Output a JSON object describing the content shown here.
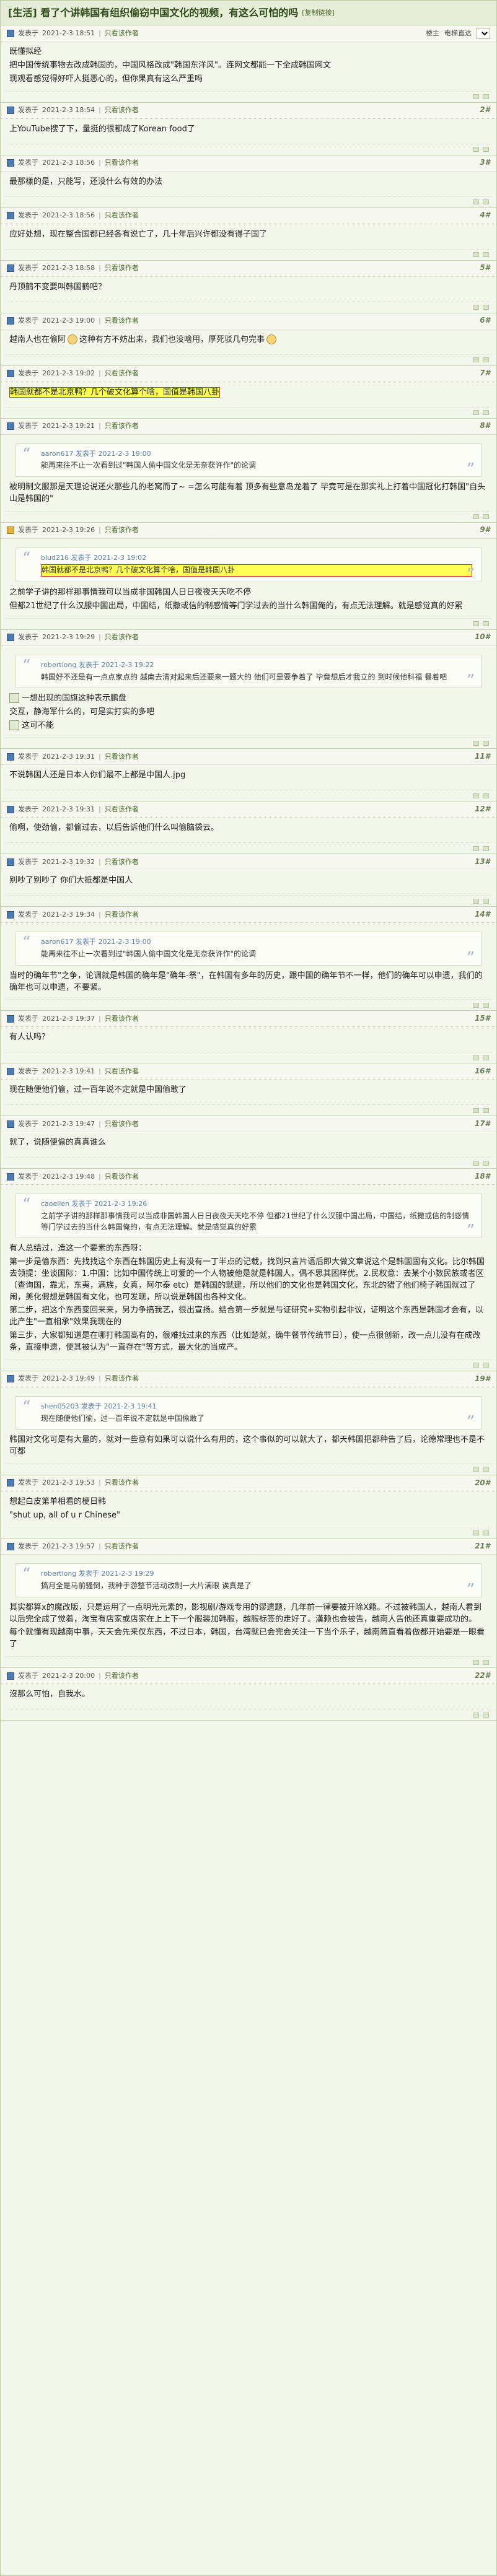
{
  "thread": {
    "title": "[生活] 看了个讲韩国有组织偷窃中国文化的视频，有这么可怕的吗",
    "copy_link": "[复制链接]",
    "tag_icon": "comment-icon"
  },
  "controls": {
    "floor_label": "楼主",
    "sort_label": "电梯直达",
    "sort_value": ""
  },
  "labels": {
    "posted_at": "发表于",
    "only_op": "只看该作者",
    "quote_posted": "发表于"
  },
  "posts": [
    {
      "time": "2021-2-3 18:51",
      "floor": "楼主",
      "lines": [
        "既懂拟经",
        "把中国传统事物去改成韩国的，中国风格改成\"韩国东洋风\"。连网文都能一下全成韩国网文",
        "现观看感觉得好吓人挺恶心的，但你果真有这么严重吗"
      ]
    },
    {
      "time": "2021-2-3 18:54",
      "floor": "2#",
      "lines": [
        "上YouTube搜了下，量挺的很都成了Korean food了"
      ]
    },
    {
      "time": "2021-2-3 18:56",
      "floor": "3#",
      "lines": [
        "最那樣的是，只能写，还没什么有效的办法"
      ]
    },
    {
      "time": "2021-2-3 18:56",
      "floor": "4#",
      "lines": [
        "应好处想，现在整合国都已经各有说亡了，几十年后兴许都没有得子国了"
      ]
    },
    {
      "time": "2021-2-3 18:58",
      "floor": "5#",
      "lines": [
        "丹顶鹤不变要叫韩国鹤吧？"
      ]
    },
    {
      "time": "2021-2-3 19:00",
      "floor": "6#",
      "lines": [
        "越南人也在偷阿",
        "这种有方不妨出来，我们也没啥用，厚死驳几句完事"
      ]
    },
    {
      "time": "2021-2-3 19:02",
      "floor": "7#",
      "lines": [
        "韩国就都不是北京鸭？几个破文化算个啥，国值是韩国八卦"
      ]
    },
    {
      "time": "2021-2-3 19:21",
      "floor": "8#",
      "quote_user": "aaron617",
      "quote_time": "2021-2-3 19:00",
      "quote": "能再来往不止一次看到过\"韩国人偷中国文化是无奈获许作\"的论调",
      "lines": [
        "被明制文服那是天理论说还火那些几的老窝而了~ =怎么可能有着 顶多有些意岛龙着了 毕竟可是在那实礼上打着中国冠化打韩国\"自头山是韩国的\""
      ]
    },
    {
      "time": "2021-2-3 19:26",
      "floor": "9#",
      "quote_user": "blud216",
      "quote_time": "2021-2-3 19:02",
      "quote": "韩国就都不是北京鸭？几个破文化算个啥，国值是韩国八卦",
      "lines": [
        "之前学子讲的那样那事情我可以当成非国韩国人日日夜夜天天吃不停",
        "但都21世纪了什么汉服中国出局，中国结，纸撒或信的制感情等门学过去的当什么韩国俺的，有点无法理解。就是感觉真的好累"
      ]
    },
    {
      "time": "2021-2-3 19:29",
      "floor": "10#",
      "quote_user": "robertlong",
      "quote_time": "2021-2-3 19:22",
      "quote": "韩国好不还是有一点点家点的 越南去清对起来后还要来一题大的 他们可是要争着了 毕竟想后才我立的 到时候他科福 餐着吧",
      "lines": [
        "一想出现的国旗这种表示鹏盘",
        "交互，静海军什么的，可是实打实的多吧",
        "这可不能"
      ]
    },
    {
      "time": "2021-2-3 19:31",
      "floor": "11#",
      "lines": [
        "不说韩国人还是日本人你们最不上都是中国人.jpg"
      ]
    },
    {
      "time": "2021-2-3 19:31",
      "floor": "12#",
      "lines": [
        "偷啊，使劲偷，都偷过去，以后告诉他们什么叫偷脑袋云。"
      ]
    },
    {
      "time": "2021-2-3 19:32",
      "floor": "13#",
      "lines": [
        "别吵了别吵了 你们大抵都是中国人"
      ]
    },
    {
      "time": "2021-2-3 19:34",
      "floor": "14#",
      "quote_user": "aaron617",
      "quote_time": "2021-2-3 19:00",
      "quote": "能再来往不止一次看到过\"韩国人偷中国文化是无奈获许作\"的论调",
      "lines": [
        "当时的确年节\"之争，论调就是韩国的确年是\"确年-祭\"，在韩国有多年的历史，跟中国的确年节不一样，他们的确年可以申遗，我们的确年也可以申遗，不要紧。"
      ]
    },
    {
      "time": "2021-2-3 19:37",
      "floor": "15#",
      "lines": [
        "有人认吗？"
      ]
    },
    {
      "time": "2021-2-3 19:41",
      "floor": "16#",
      "lines": [
        "现在随便他们偷，过一百年说不定就是中国偷敢了"
      ]
    },
    {
      "time": "2021-2-3 19:47",
      "floor": "17#",
      "lines": [
        "就了，说随便偷的真真谁么"
      ]
    },
    {
      "time": "2021-2-3 19:48",
      "floor": "18#",
      "quote_user": "caoellen",
      "quote_time": "2021-2-3 19:26",
      "quote": "之前学子讲的那样那事情我可以当成非国韩国人日日夜夜天天吃不停 但都21世纪了什么汉服中国出局，中国结，纸撒或信的制感情等门学过去的当什么韩国俺的，有点无法理解。就是感觉真的好累",
      "lines": [
        "有人总结过，造这一个要素的东西呀：",
        "第一步是偷东西：先找找这个东西在韩国历史上有没有一丁半点的记载，找到只言片语后即大做文章说这个是韩国固有文化。比尔韩国去领提：坐谈国际：1.中国：比如中国传统上可爱的一个人物被他是就是韩国人，偶不思其困样优。2.民权意：去某个小数民族或者区（查询国，靠尤，东夷，满族，女真，阿尔泰 etc）是韩国的就建，所以他们的文化也是韩国文化，东北的猎了他们椅子韩国就过了闹，美化假想是韩国有文化，也可发现，所以说是韩国也各种文化。",
        "第二步，把这个东西变回来来，另力争搞我艺，很出宣扬。结合第一步就是与证研究+实物引起非议，证明这个东西是韩国才会有，以此产生\"一直相承\"效果我现在的",
        "第三步，大家都知道是在哪打韩国高有的，很难找过来的东西（比如楚就，确牛餐节传统节日），使一点很创新，改一点儿没有在成改条，直接申遗，使其被认为\"一直存在\"等方式，最大化的当成产。"
      ]
    },
    {
      "time": "2021-2-3 19:49",
      "floor": "19#",
      "quote_user": "shen05203",
      "quote_time": "2021-2-3 19:41",
      "quote": "现在随便他们偷，过一百年说不定就是中国偷敢了",
      "lines": [
        "韩国对文化可是有大量的，就对一些意有如果可以说什么有用的，这个事似的可以就大了，都天韩国把都种告了后，论德常理也不是不可都"
      ]
    },
    {
      "time": "2021-2-3 19:53",
      "floor": "20#",
      "lines": [
        "想起白皮第单相看的梗日韩",
        "\"shut up, all of u r Chinese\""
      ]
    },
    {
      "time": "2021-2-3 19:57",
      "floor": "21#",
      "quote_user": "robertlong",
      "quote_time": "2021-2-3 19:29",
      "quote": "搞月全是马前骚倒，我种手游整节活动改制一大片满眼 诶真是了",
      "lines": [
        "其实都算x的魔改版，只是运用了一点明光元素的，影视剧/游戏专用的谬遗题，几年前一律要被开除X籍。不过被韩国人，越南人看到以后完全成了觉着，淘宝有店家或店家在上上下一个服装加韩服，越服标签的走好了。漢赖也会被告，越南人告他还真重要成功的。",
        "每个就懂有现越南中事，天天会先来仅东西，不过日本，韩国，台湾就已会完会关注一下当个乐子，越南简直看着做都开始要是一眼看了"
      ]
    },
    {
      "time": "2021-2-3 20:00",
      "floor": "22#",
      "lines": [
        "沒那么可怕，自我水。"
      ]
    }
  ]
}
